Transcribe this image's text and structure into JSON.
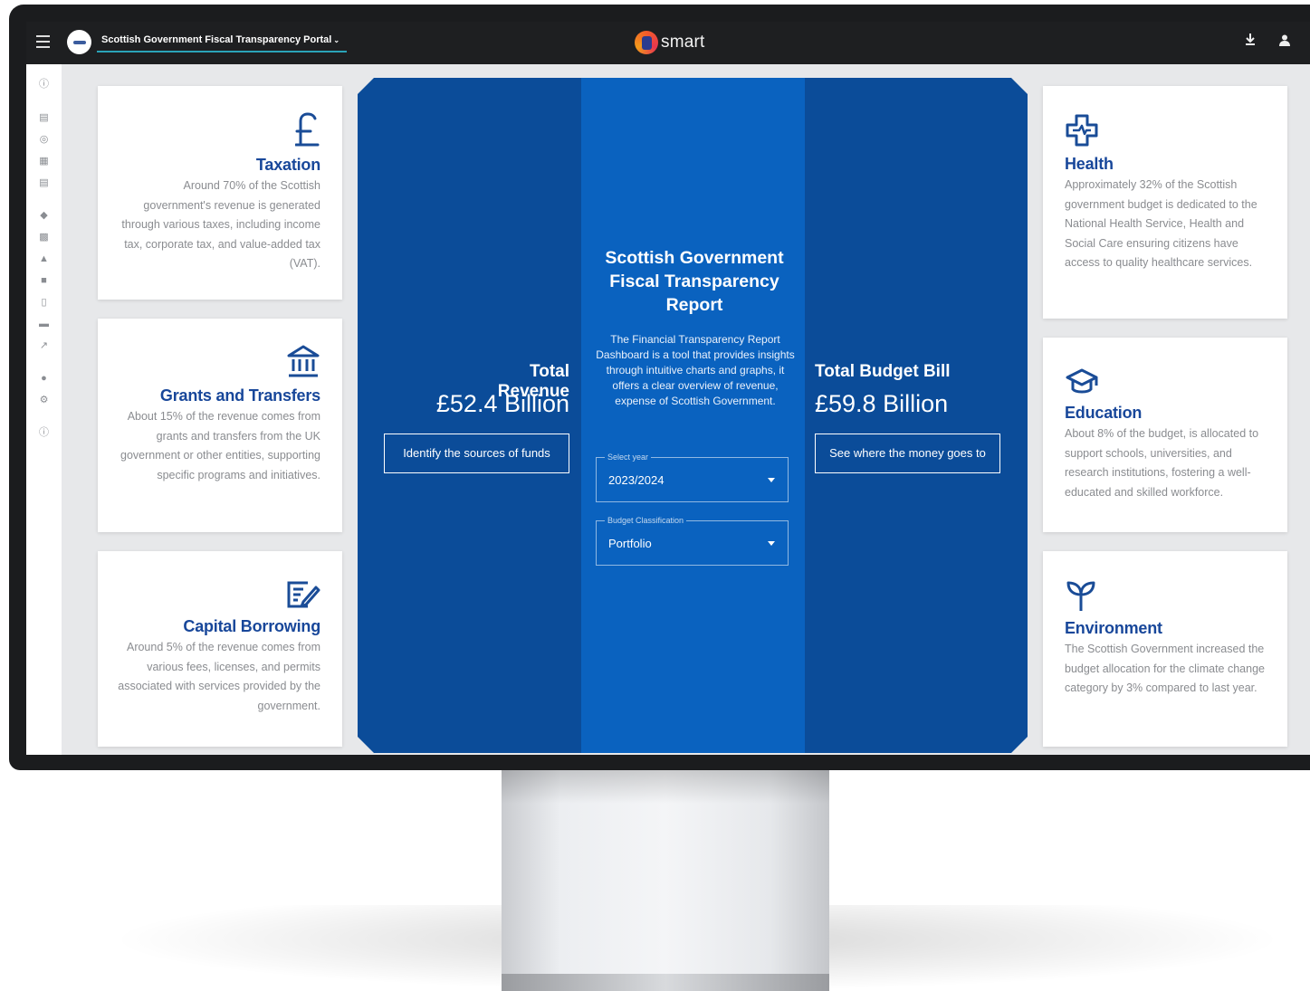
{
  "topbar": {
    "portal_title": "Scottish Government Fiscal Transparency Portal",
    "brand": "smart"
  },
  "left_cards": [
    {
      "icon": "pound-icon",
      "title": "Taxation",
      "text": "Around 70% of the Scottish government's revenue is generated through various taxes, including income tax, corporate tax, and value-added tax (VAT)."
    },
    {
      "icon": "bank-icon",
      "title": "Grants and Transfers",
      "text": "About 15% of the revenue comes from grants and transfers from the UK government or other entities, supporting specific programs and initiatives."
    },
    {
      "icon": "edit-note-icon",
      "title": "Capital Borrowing",
      "text": "Around 5% of the revenue comes from various fees, licenses, and permits associated with services provided by the government."
    }
  ],
  "right_cards": [
    {
      "icon": "health-cross-icon",
      "title": "Health",
      "text": "Approximately 32% of the Scottish government budget is dedicated to the National Health Service, Health and Social Care ensuring citizens have access to quality healthcare services."
    },
    {
      "icon": "graduation-cap-icon",
      "title": "Education",
      "text": "About 8% of the budget, is allocated to support schools, universities, and research institutions, fostering a well-educated and skilled workforce."
    },
    {
      "icon": "sprout-icon",
      "title": "Environment",
      "text": "The Scottish Government increased the budget allocation for the climate change category by 3% compared to last year."
    }
  ],
  "revenue": {
    "label": "Total Revenue",
    "value": "£52.4 Billion",
    "button": "Identify the sources of funds"
  },
  "budget": {
    "label": "Total Budget Bill",
    "value": "£59.8 Billion",
    "button": "See where the money goes to"
  },
  "report": {
    "title": "Scottish Government Fiscal Transparency Report",
    "description": "The Financial Transparency Report Dashboard is a tool that provides insights through intuitive charts and graphs, it offers a clear overview of revenue, expense of Scottish Government."
  },
  "filters": {
    "year_label": "Select year",
    "year_value": "2023/2024",
    "classification_label": "Budget Classification",
    "classification_value": "Portfolio"
  },
  "colors": {
    "accent_dark": "#0b4c99",
    "accent_mid": "#0a62bf",
    "title_blue": "#18479a"
  }
}
